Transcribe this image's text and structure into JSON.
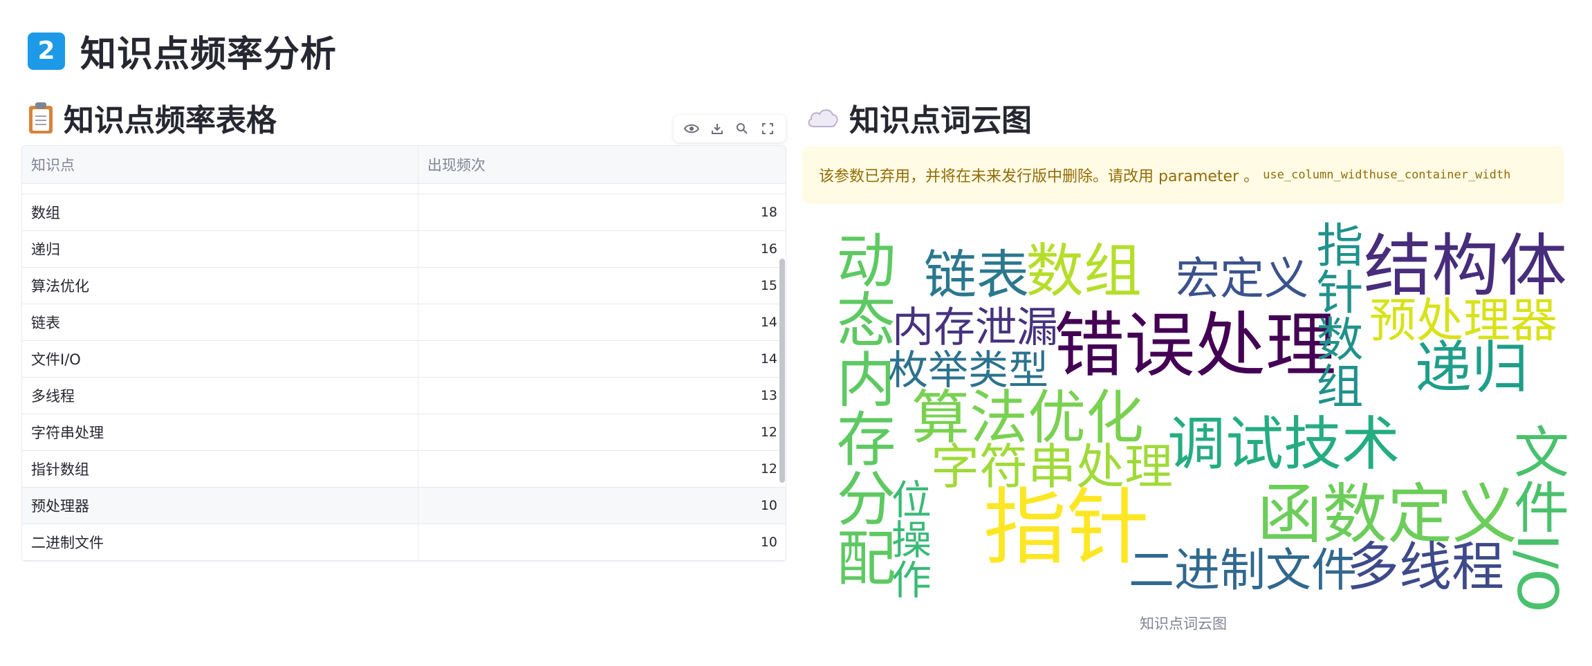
{
  "section": {
    "number": "2",
    "title": "知识点频率分析"
  },
  "table_panel": {
    "title": "知识点频率表格",
    "columns": [
      "知识点",
      "出现频次"
    ],
    "rows": [
      {
        "name": "数组",
        "count": "18"
      },
      {
        "name": "递归",
        "count": "16"
      },
      {
        "name": "算法优化",
        "count": "15"
      },
      {
        "name": "链表",
        "count": "14"
      },
      {
        "name": "文件I/O",
        "count": "14"
      },
      {
        "name": "多线程",
        "count": "13"
      },
      {
        "name": "字符串处理",
        "count": "12"
      },
      {
        "name": "指针数组",
        "count": "12"
      },
      {
        "name": "预处理器",
        "count": "10"
      },
      {
        "name": "二进制文件",
        "count": "10"
      }
    ]
  },
  "cloud_panel": {
    "title": "知识点词云图",
    "warning_text": "该参数已弃用，并将在未来发行版中删除。请改用 parameter 。",
    "warning_code": "use_column_widthuse_container_width",
    "caption": "知识点词云图",
    "words": [
      {
        "text": "结构体",
        "color": "#472d7b"
      },
      {
        "text": "错误处理",
        "color": "#440154"
      },
      {
        "text": "链表",
        "color": "#2a788e"
      },
      {
        "text": "数组",
        "color": "#b5de2b"
      },
      {
        "text": "宏定义",
        "color": "#3b528b"
      },
      {
        "text": "指针数组",
        "color": "#21918c"
      },
      {
        "text": "预处理器",
        "color": "#d8e219"
      },
      {
        "text": "内存泄漏",
        "color": "#46327e"
      },
      {
        "text": "动态内存分配",
        "color": "#5ec962"
      },
      {
        "text": "枚举类型",
        "color": "#2c728e"
      },
      {
        "text": "递归",
        "color": "#1f9e89"
      },
      {
        "text": "算法优化",
        "color": "#7ad151"
      },
      {
        "text": "调试技术",
        "color": "#25ac82"
      },
      {
        "text": "字符串处理",
        "color": "#a0da39"
      },
      {
        "text": "函数定义",
        "color": "#6ccd5a"
      },
      {
        "text": "指针",
        "color": "#fde725"
      },
      {
        "text": "位操作",
        "color": "#3aba76"
      },
      {
        "text": "二进制文件",
        "color": "#31688e"
      },
      {
        "text": "多线程",
        "color": "#3e4a89"
      },
      {
        "text": "文件I/O",
        "color": "#4ac16d"
      }
    ]
  }
}
